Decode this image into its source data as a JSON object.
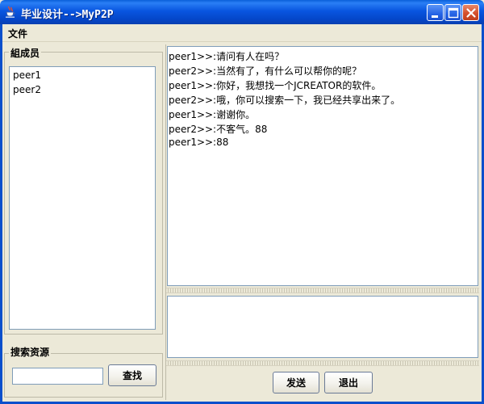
{
  "window": {
    "title": "毕业设计-->MyP2P"
  },
  "menu": {
    "items": [
      "文件"
    ]
  },
  "members_panel": {
    "title": "組成员",
    "members": [
      "peer1",
      "peer2"
    ]
  },
  "search_panel": {
    "title": "搜索资源",
    "input_value": "",
    "button_label": "查找"
  },
  "chat": {
    "messages": [
      "peer1>>:请问有人在吗？",
      "peer2>>:当然有了，有什么可以帮你的呢？",
      "peer1>>:你好，我想找一个JCREATOR的软件。",
      "peer2>>:哦，你可以搜索一下，我已经共享出来了。",
      "peer1>>:谢谢你。",
      "peer2>>:不客气。88",
      "peer1>>:88"
    ],
    "input_value": ""
  },
  "actions": {
    "send_label": "发送",
    "exit_label": "退出"
  },
  "icons": {
    "app": "java-cup-icon",
    "minimize": "minimize-icon",
    "maximize": "maximize-icon",
    "close": "close-icon"
  }
}
